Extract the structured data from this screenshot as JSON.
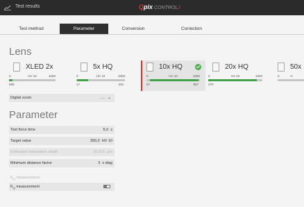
{
  "window": {
    "title": "Test results"
  },
  "brand": {
    "q": "Q",
    "pix": "pix",
    "control": "CONTROL",
    "x": "2"
  },
  "tabs": [
    {
      "label": "Test method",
      "active": false
    },
    {
      "label": "Parameter",
      "active": true
    },
    {
      "label": "Conversion",
      "active": false
    },
    {
      "label": "Correction",
      "active": false
    }
  ],
  "lens": {
    "title": "Lens",
    "items": [
      {
        "name": "XLED 2x",
        "scale_min": "0",
        "scale_unit": "HV 10",
        "scale_max": "1000",
        "range_min": "569",
        "range_max": "",
        "fill": [
          0.0,
          0.08
        ],
        "selected": false
      },
      {
        "name": "5x HQ",
        "scale_min": "0",
        "scale_unit": "HV 10",
        "scale_max": "1000",
        "range_min": "17",
        "range_max": "240",
        "fill": [
          0.02,
          0.24
        ],
        "selected": false
      },
      {
        "name": "10x HQ",
        "scale_min": "0",
        "scale_unit": "HV 10",
        "scale_max": "1000",
        "range_min": "67",
        "range_max": "967",
        "fill": [
          0.07,
          0.97
        ],
        "selected": true
      },
      {
        "name": "20x HQ",
        "scale_min": "0",
        "scale_unit": "HV 10",
        "scale_max": "1000",
        "range_min": "270",
        "range_max": "",
        "fill": [
          0.0,
          0.9
        ],
        "selected": false
      },
      {
        "name": "50x",
        "scale_min": "0",
        "scale_unit": "H",
        "scale_max": "",
        "range_min": "",
        "range_max": "",
        "fill": [
          0.0,
          0.0
        ],
        "selected": false
      }
    ]
  },
  "digital_zoom": {
    "label": "Digital zoom",
    "value": "....",
    "chevron": "⌄"
  },
  "parameter": {
    "title": "Parameter",
    "rows": [
      {
        "label": "Test force time",
        "value": "5,0",
        "unit": "s",
        "disabled": false
      },
      {
        "label": "Target value",
        "value": "300,0",
        "unit": "HV 10",
        "disabled": false
      },
      {
        "label": "Estimated indentation depth",
        "value": "35,515",
        "unit": "µm",
        "disabled": true
      },
      {
        "label": "Minimum distance factor",
        "value": "3",
        "unit": "x diag",
        "disabled": false
      }
    ],
    "kq_label": "K",
    "kq_sub": "Q",
    "kq_text": "measurement",
    "kq_toggle_sub": "Q",
    "kq_toggle_text": "measurement",
    "kq_toggle_on": false
  },
  "colors": {
    "accent": "#d8342b",
    "fill_green": "#40a34a",
    "header": "#2b2b2b"
  },
  "icons": {
    "window": "chart-icon",
    "check": "check-circle-icon",
    "dropdown": "chevron-down-icon"
  }
}
